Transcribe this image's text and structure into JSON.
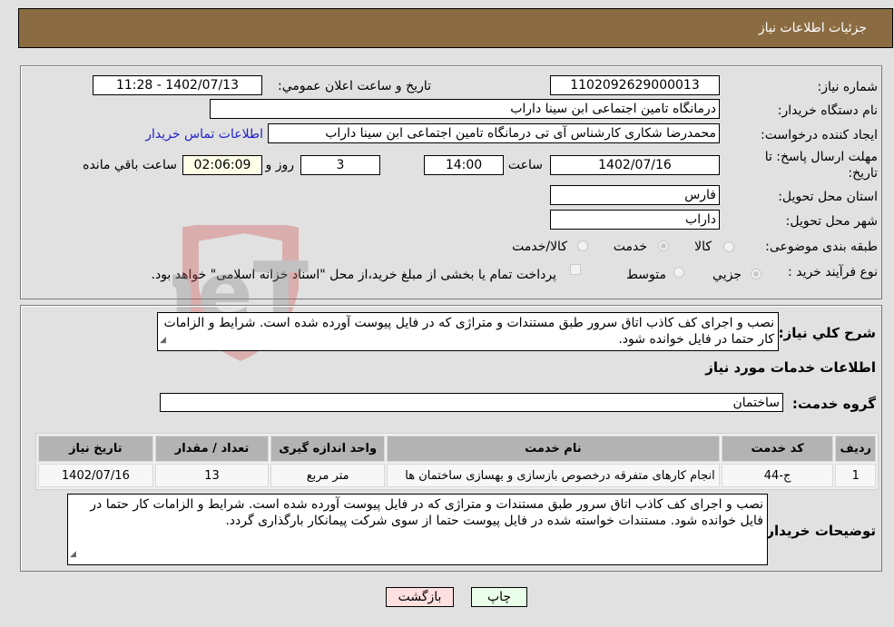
{
  "header": {
    "title": "جزئیات اطلاعات نیاز"
  },
  "details": {
    "need_number_label": "شماره نیاز:",
    "need_number": "1102092629000013",
    "announce_label": "تاریخ و ساعت اعلان عمومي:",
    "announce_value": "1402/07/13 - 11:28",
    "buyer_org_label": "نام دستگاه خريدار:",
    "buyer_org": "درمانگاه تامین اجتماعی ابن سینا داراب",
    "creator_label": "ایجاد کننده درخواست:",
    "creator": "محمدرضا شکاری کارشناس آی تی درمانگاه تامین اجتماعی ابن سینا داراب",
    "contact_link": "اطلاعات تماس خریدار",
    "deadline_label_line1": "مهلت ارسال پاسخ: تا",
    "deadline_label_line2": "تاریخ:",
    "deadline_date": "1402/07/16",
    "time_label": "ساعت",
    "deadline_time": "14:00",
    "days_value": "3",
    "days_label": "روز و",
    "remaining_time": "02:06:09",
    "remaining_label": "ساعت باقي مانده",
    "province_label": "استان محل تحویل:",
    "province": "فارس",
    "city_label": "شهر محل تحویل:",
    "city": "داراب",
    "category_label": "طبقه بندی موضوعی:",
    "category_options": [
      {
        "label": "کالا",
        "checked": false
      },
      {
        "label": "خدمت",
        "checked": true
      },
      {
        "label": "کالا/خدمت",
        "checked": false
      }
    ],
    "process_label": "نوع فرآیند خرید :",
    "process_options": [
      {
        "label": "جزيي",
        "checked": true
      },
      {
        "label": "متوسط",
        "checked": false
      }
    ],
    "treasury_note": "پرداخت تمام یا بخشی از مبلغ خرید،از محل \"اسناد خزانه اسلامی\" خواهد بود."
  },
  "summary": {
    "label": "شرح کلي نياز:",
    "text": "نصب و اجرای کف کاذب اتاق سرور طبق مستندات و متراژی که در فایل پیوست آورده شده است. شرایط و الزامات کار حتما در فایل خوانده شود."
  },
  "services": {
    "section_title": "اطلاعات خدمات مورد نیاز",
    "group_label": "گروه خدمت:",
    "group_value": "ساختمان",
    "columns": [
      "ردیف",
      "کد خدمت",
      "نام خدمت",
      "واحد اندازه گیری",
      "تعداد / مقدار",
      "تاریخ نیاز"
    ],
    "rows": [
      [
        "1",
        "ج-44",
        "انجام کارهای متفرقه درخصوص بازسازی و بهسازی ساختمان ها",
        "متر مربع",
        "13",
        "1402/07/16"
      ]
    ]
  },
  "buyer_notes": {
    "label": "توضیحات خریدار:",
    "text": "نصب و اجرای کف کاذب اتاق سرور طبق مستندات و متراژی که در فایل پیوست آورده شده است. شرایط و الزامات کار حتما در فایل خوانده شود.  مستندات خواسته شده در فایل پیوست حتما از سوی شرکت پیمانکار بارگذاری گردد."
  },
  "buttons": {
    "print": "چاپ",
    "back": "بازگشت"
  },
  "colors": {
    "header_bg": "#8b6c42",
    "print_bg": "#eaffea",
    "back_bg": "#ffe0e0",
    "link": "#2020c8"
  },
  "watermark": {
    "text": "AriaTender.neT"
  }
}
